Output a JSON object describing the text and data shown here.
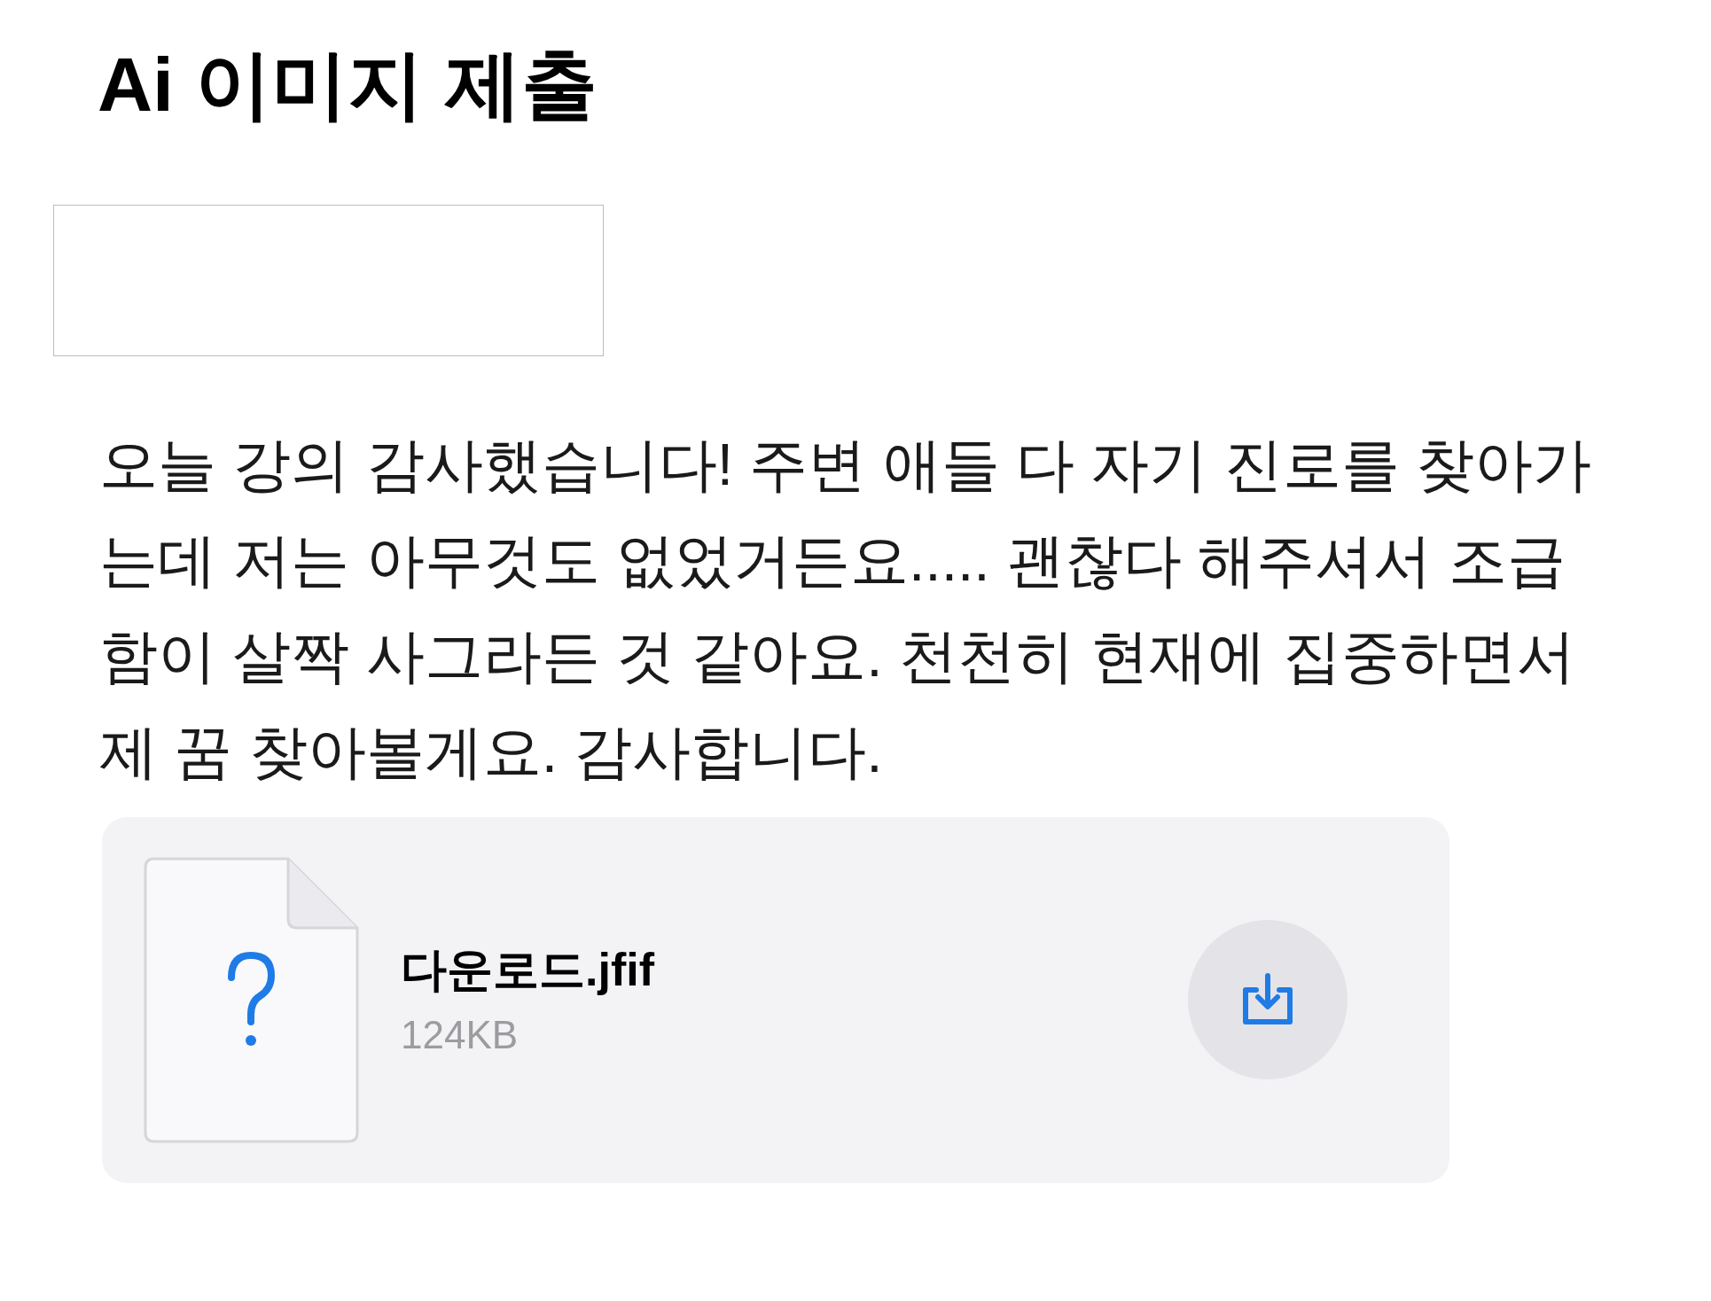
{
  "title": "Ai 이미지 제출",
  "message": "오늘 강의 감사했습니다! 주변 애들 다 자기 진로를 찾아가는데 저는 아무것도 없었거든요..... 괜찮다 해주셔서 조급함이 살짝 사그라든 것 같아요. 천천히 현재에 집중하면서 제 꿈 찾아볼게요. 감사합니다.",
  "attachment": {
    "file_name": "다운로드.jfif",
    "file_size": "124KB"
  }
}
